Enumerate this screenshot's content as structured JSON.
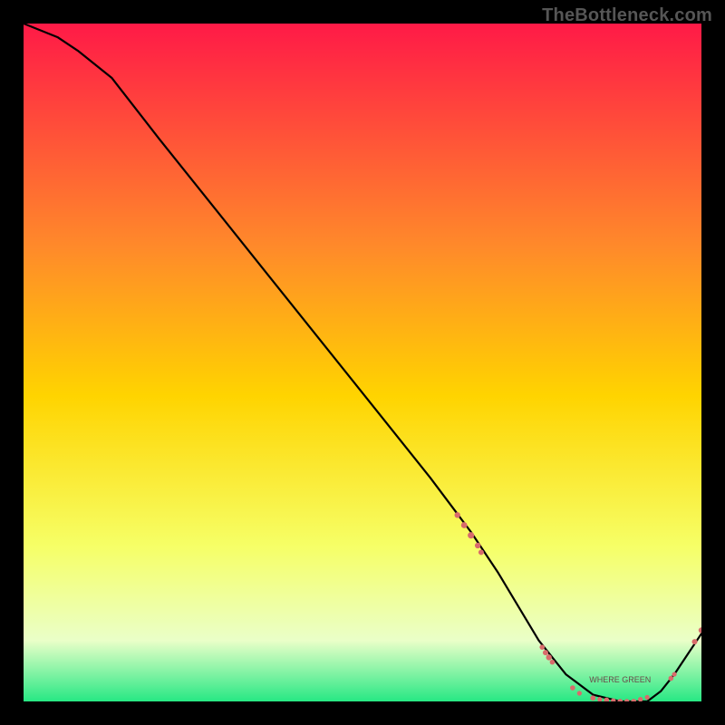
{
  "watermark": "TheBottleneck.com",
  "colors": {
    "frame_bg": "#000000",
    "grad_top": "#ff1a47",
    "grad_mid1": "#ff8a2a",
    "grad_mid2": "#ffd400",
    "grad_mid3": "#f6ff66",
    "grad_low": "#eaffc8",
    "grad_green": "#27e884",
    "line": "#000000",
    "marker": "#d86b6b"
  },
  "chart_data": {
    "type": "line",
    "title": "",
    "xlabel": "",
    "ylabel": "",
    "xlim": [
      0,
      100
    ],
    "ylim": [
      0,
      100
    ],
    "series": [
      {
        "name": "bottleneck-curve",
        "x": [
          0,
          5,
          8,
          13,
          20,
          28,
          36,
          44,
          52,
          60,
          66,
          70,
          73,
          76,
          80,
          84,
          88,
          92,
          94,
          96,
          98,
          100
        ],
        "y": [
          100,
          98,
          96,
          92,
          83,
          73,
          63,
          53,
          43,
          33,
          25,
          19,
          14,
          9,
          4,
          1,
          0,
          0,
          1.5,
          4,
          7,
          10
        ]
      }
    ],
    "markers": [
      {
        "x": 64.0,
        "y": 27.5,
        "r": 3.2
      },
      {
        "x": 65.0,
        "y": 26.0,
        "r": 3.4
      },
      {
        "x": 66.0,
        "y": 24.5,
        "r": 3.6
      },
      {
        "x": 67.0,
        "y": 23.0,
        "r": 3.2
      },
      {
        "x": 67.5,
        "y": 22.0,
        "r": 3.0
      },
      {
        "x": 76.5,
        "y": 8.0,
        "r": 2.8
      },
      {
        "x": 77.0,
        "y": 7.2,
        "r": 3.0
      },
      {
        "x": 77.5,
        "y": 6.5,
        "r": 3.2
      },
      {
        "x": 78.0,
        "y": 5.8,
        "r": 2.8
      },
      {
        "x": 81.0,
        "y": 2.0,
        "r": 2.8
      },
      {
        "x": 82.0,
        "y": 1.2,
        "r": 2.6
      },
      {
        "x": 84.0,
        "y": 0.5,
        "r": 2.9
      },
      {
        "x": 85.0,
        "y": 0.3,
        "r": 2.7
      },
      {
        "x": 86.0,
        "y": 0.2,
        "r": 2.9
      },
      {
        "x": 87.0,
        "y": 0.1,
        "r": 2.7
      },
      {
        "x": 88.0,
        "y": 0.0,
        "r": 2.9
      },
      {
        "x": 89.0,
        "y": 0.0,
        "r": 2.7
      },
      {
        "x": 90.0,
        "y": 0.0,
        "r": 2.9
      },
      {
        "x": 91.0,
        "y": 0.3,
        "r": 2.7
      },
      {
        "x": 92.0,
        "y": 0.6,
        "r": 2.6
      },
      {
        "x": 95.5,
        "y": 3.4,
        "r": 2.8
      },
      {
        "x": 96.0,
        "y": 4.0,
        "r": 2.6
      },
      {
        "x": 99.0,
        "y": 8.8,
        "r": 3.0
      },
      {
        "x": 100.0,
        "y": 10.5,
        "r": 3.2
      }
    ],
    "valley_label": {
      "text": "WHERE GREEN",
      "x": 88,
      "y": 2.8
    }
  }
}
